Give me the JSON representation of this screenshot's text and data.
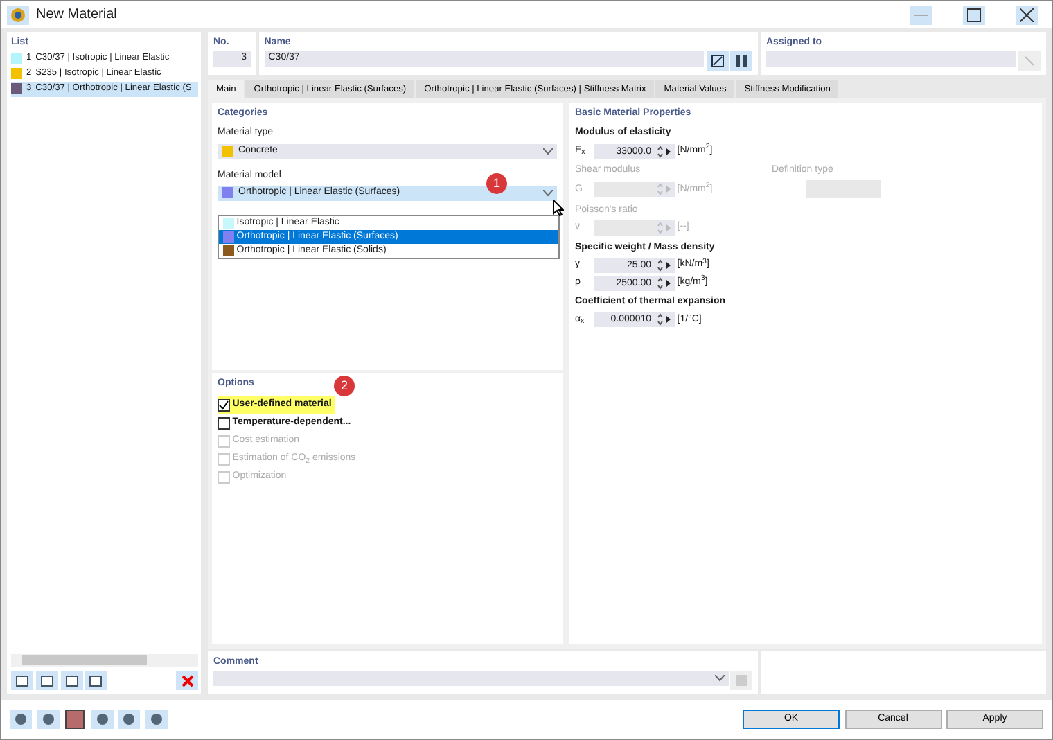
{
  "window": {
    "title": "New Material"
  },
  "list": {
    "title": "List",
    "items": [
      {
        "number": "1",
        "name": "C30/37 | Isotropic | Linear Elastic",
        "color": "#b3f5fb",
        "selected": false
      },
      {
        "number": "2",
        "name": "S235 | Isotropic | Linear Elastic",
        "color": "#f2c200",
        "selected": false
      },
      {
        "number": "3",
        "name": "C30/37 | Orthotropic | Linear Elastic (S",
        "color": "#6b5b7b",
        "selected": true
      }
    ]
  },
  "number": {
    "label": "No.",
    "value": "3"
  },
  "name": {
    "label": "Name",
    "value": "C30/37"
  },
  "assigned_to": {
    "label": "Assigned to"
  },
  "tabs": [
    {
      "label": "Main",
      "selected": true
    },
    {
      "label": "Orthotropic | Linear Elastic (Surfaces)",
      "selected": false
    },
    {
      "label": "Orthotropic | Linear Elastic (Surfaces) | Stiffness Matrix",
      "selected": false
    },
    {
      "label": "Material Values",
      "selected": false
    },
    {
      "label": "Stiffness Modification",
      "selected": false
    }
  ],
  "categories": {
    "title": "Categories",
    "material_type": {
      "label": "Material type",
      "value": "Concrete",
      "color": "#f2c200"
    },
    "material_model": {
      "label": "Material model",
      "value": "Orthotropic | Linear Elastic (Surfaces)",
      "color": "#8080f0",
      "expanded": true,
      "callout": "1",
      "options": [
        {
          "label": "Isotropic | Linear Elastic",
          "color": "#c8f8fc",
          "selected": false
        },
        {
          "label": "Orthotropic | Linear Elastic (Surfaces)",
          "color": "#8080f0",
          "selected": true
        },
        {
          "label": "Orthotropic | Linear Elastic (Solids)",
          "color": "#8b5a1c",
          "selected": false
        }
      ]
    }
  },
  "options": {
    "title": "Options",
    "callout": "2",
    "items": [
      {
        "label": "User-defined material",
        "checked": true,
        "disabled": false,
        "highlighted": true
      },
      {
        "label": "Temperature-dependent...",
        "checked": false,
        "disabled": false,
        "highlighted": false
      },
      {
        "label": "Cost estimation",
        "checked": false,
        "disabled": true,
        "highlighted": false
      },
      {
        "label": "Estimation of CO$_{2}$ emissions",
        "checked": false,
        "disabled": true,
        "highlighted": false
      },
      {
        "label": "Optimization",
        "checked": false,
        "disabled": true,
        "highlighted": false
      }
    ]
  },
  "properties": {
    "title": "Basic Material Properties",
    "groups": [
      {
        "title": "Modulus of elasticity",
        "disabled": false,
        "rows": [
          {
            "symbol": "E$_{x}$",
            "value": "33000.0",
            "unit": "[N/mm$^{2}$]"
          }
        ]
      },
      {
        "title": "Shear modulus",
        "disabled": true,
        "extra_label": "Definition type",
        "rows": [
          {
            "symbol": "G",
            "unit": "[N/mm$^{2}$]"
          }
        ]
      },
      {
        "title": "Poisson's ratio",
        "disabled": true,
        "rows": [
          {
            "symbol": "ν",
            "unit": "[--]"
          }
        ]
      },
      {
        "title": "Specific weight / Mass density",
        "disabled": false,
        "rows": [
          {
            "symbol": "γ",
            "value": "25.00",
            "unit": "[kN/m$^{3}$]"
          },
          {
            "symbol": "ρ",
            "value": "2500.00",
            "unit": "[kg/m$^{3}$]"
          }
        ]
      },
      {
        "title": "Coefficient of thermal expansion",
        "disabled": false,
        "rows": [
          {
            "symbol": "α$_{x}$",
            "value": "0.000010",
            "unit": "[1/°C]"
          }
        ]
      }
    ]
  },
  "comment": {
    "label": "Comment"
  },
  "buttons": [
    {
      "label": "OK",
      "default": true
    },
    {
      "label": "Cancel",
      "default": false
    },
    {
      "label": "Apply",
      "default": false
    }
  ]
}
